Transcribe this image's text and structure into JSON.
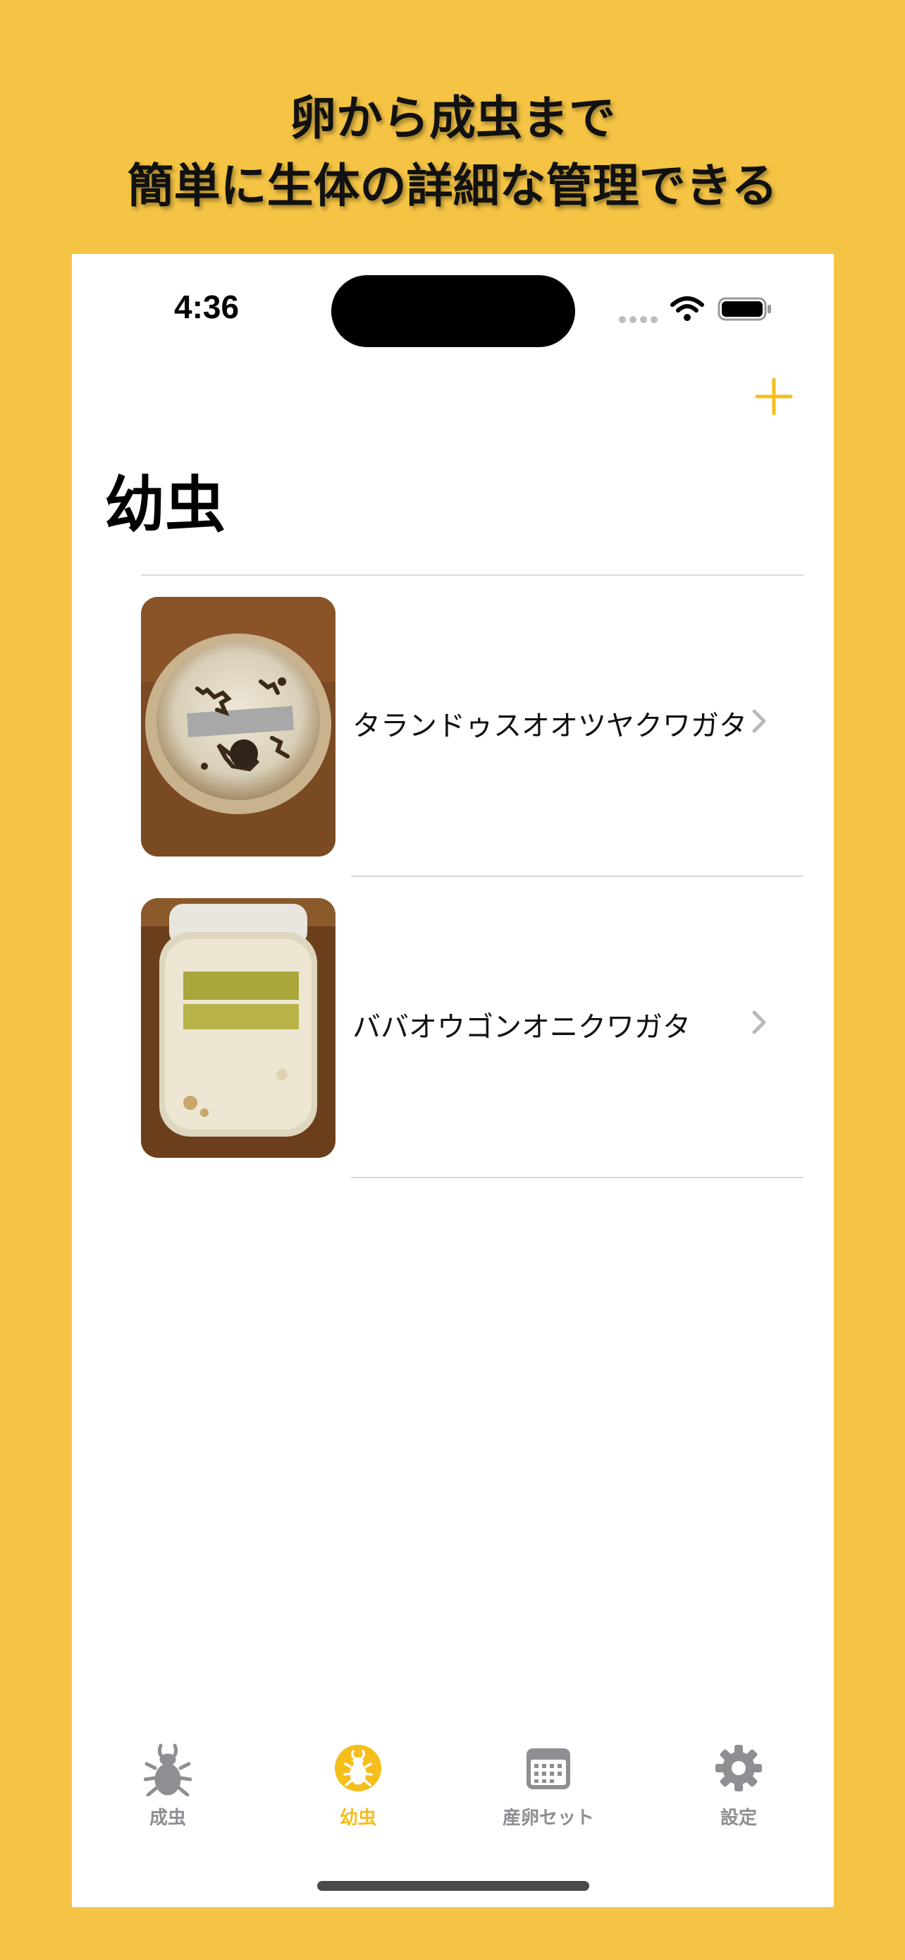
{
  "promo": {
    "line1": "卵から成虫まで",
    "line2": "簡単に生体の詳細な管理できる"
  },
  "status_bar": {
    "time": "4:36"
  },
  "nav": {
    "title": "幼虫",
    "add_icon": "plus-icon"
  },
  "list": {
    "items": [
      {
        "name": "タランドゥスオオツヤクワガタ",
        "thumb": "larva-cup-photo"
      },
      {
        "name": "ババオウゴンオニクワガタ",
        "thumb": "larva-bottle-photo"
      }
    ]
  },
  "tabbar": {
    "tabs": [
      {
        "label": "成虫",
        "icon": "beetle-icon",
        "active": false
      },
      {
        "label": "幼虫",
        "icon": "larva-icon",
        "active": true
      },
      {
        "label": "産卵セット",
        "icon": "calendar-icon",
        "active": false
      },
      {
        "label": "設定",
        "icon": "gear-icon",
        "active": false
      }
    ]
  },
  "colors": {
    "brand": "#F5C444",
    "accent": "#F5BE1B",
    "inactive": "#8E8E93"
  }
}
